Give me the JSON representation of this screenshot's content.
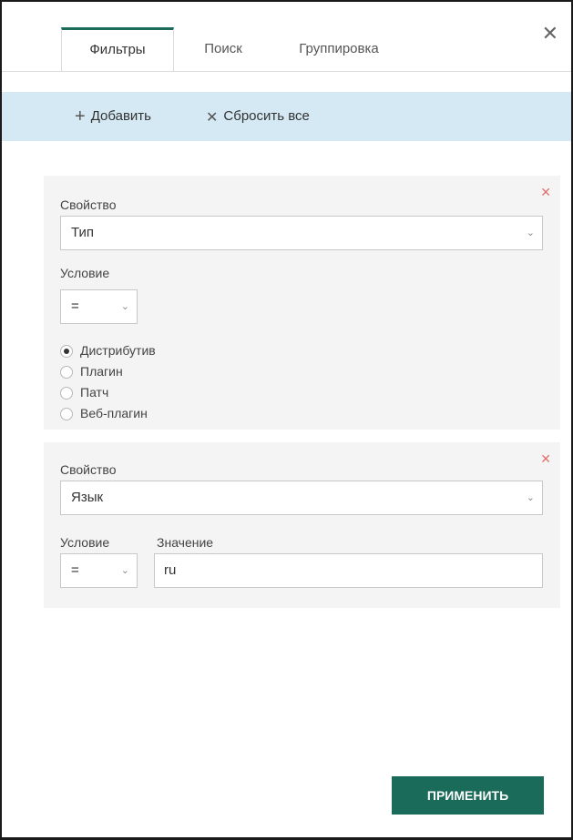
{
  "tabs": [
    {
      "label": "Фильтры",
      "active": true
    },
    {
      "label": "Поиск",
      "active": false
    },
    {
      "label": "Группировка",
      "active": false
    }
  ],
  "toolbar": {
    "add_label": "Добавить",
    "reset_label": "Сбросить все"
  },
  "filters": [
    {
      "property_label": "Свойство",
      "property_value": "Тип",
      "condition_label": "Условие",
      "condition_value": "=",
      "options": [
        {
          "label": "Дистрибутив",
          "selected": true
        },
        {
          "label": "Плагин",
          "selected": false
        },
        {
          "label": "Патч",
          "selected": false
        },
        {
          "label": "Веб-плагин",
          "selected": false
        }
      ]
    },
    {
      "property_label": "Свойство",
      "property_value": "Язык",
      "condition_label": "Условие",
      "condition_value": "=",
      "value_label": "Значение",
      "value": "ru"
    }
  ],
  "apply_label": "ПРИМЕНИТЬ",
  "colors": {
    "accent": "#1a6b5a",
    "toolbar_bg": "#d4e9f4",
    "card_bg": "#f4f4f4",
    "remove": "#e07070"
  }
}
